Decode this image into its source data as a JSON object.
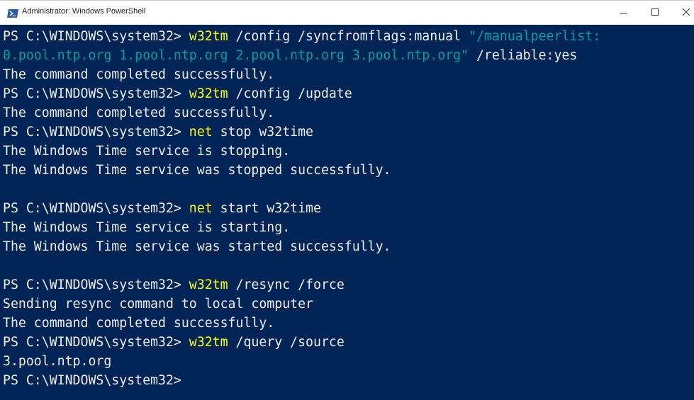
{
  "window": {
    "title": "Administrator: Windows PowerShell",
    "icon": "powershell-icon",
    "controls": {
      "minimize_icon": "minimize-icon",
      "maximize_icon": "maximize-icon",
      "close_icon": "close-icon"
    }
  },
  "colors": {
    "console_background": "#012456",
    "text": "#eeedf0",
    "command": "#ffff00",
    "string": "#00a0a0"
  },
  "console": {
    "prompt": "PS C:\\WINDOWS\\system32> ",
    "cmd1": {
      "name": "w32tm",
      "args": " /config /syncfromflags:manual ",
      "string_part1": "\"/manualpeerlist:",
      "string_part2": "0.pool.ntp.org 1.pool.ntp.org 2.pool.ntp.org 3.pool.ntp.org\"",
      "args_after": " /reliable:yes"
    },
    "out1": "The command completed successfully.",
    "cmd2": {
      "name": "w32tm",
      "args": " /config /update"
    },
    "out2": "The command completed successfully.",
    "cmd3": {
      "name": "net",
      "args": " stop w32time"
    },
    "out3": [
      "The Windows Time service is stopping.",
      "The Windows Time service was stopped successfully."
    ],
    "cmd4": {
      "name": "net",
      "args": " start w32time"
    },
    "out4": [
      "The Windows Time service is starting.",
      "The Windows Time service was started successfully."
    ],
    "cmd5": {
      "name": "w32tm",
      "args": " /resync /force"
    },
    "out5": [
      "Sending resync command to local computer",
      "The command completed successfully."
    ],
    "cmd6": {
      "name": "w32tm",
      "args": " /query /source"
    },
    "out6": "3.pool.ntp.org",
    "final_prompt": "PS C:\\WINDOWS\\system32>"
  }
}
